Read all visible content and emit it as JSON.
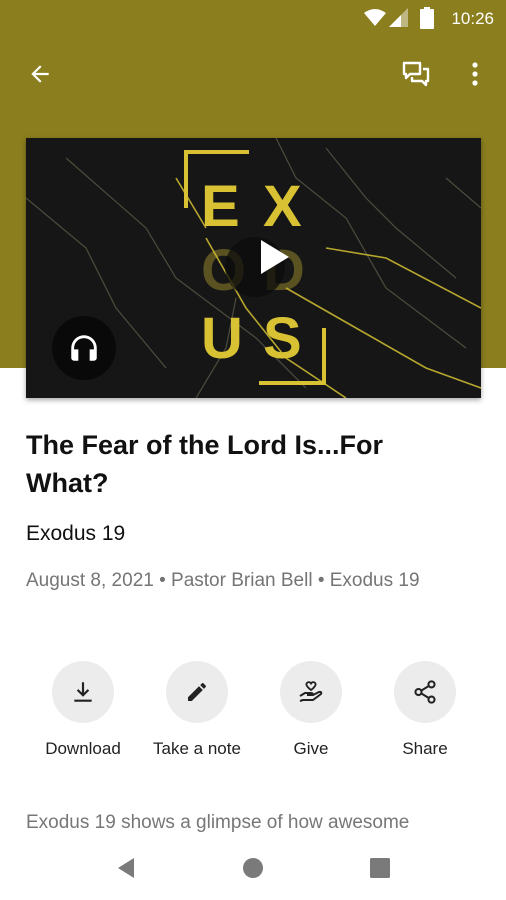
{
  "status_bar": {
    "time": "10:26",
    "icons": [
      "wifi-icon",
      "signal-icon",
      "battery-icon"
    ]
  },
  "toolbar": {
    "back_icon": "arrow-back-icon",
    "chat_icon": "chat-icon",
    "more_icon": "more-vert-icon"
  },
  "colors": {
    "header_band": "#8a7e1f",
    "artwork_accent": "#d8c234",
    "action_circle": "#ececec"
  },
  "media": {
    "artwork_text": [
      "E",
      "X",
      "O",
      "D",
      "U",
      "S"
    ],
    "play_icon": "play-icon",
    "audio_icon": "headphones-icon"
  },
  "sermon": {
    "title": "The Fear of the Lord Is...For What?",
    "subtitle": "Exodus 19",
    "meta": "August 8, 2021 • Pastor Brian Bell • Exodus 19",
    "description": "Exodus 19 shows a glimpse of how awesome"
  },
  "actions": [
    {
      "label": "Download",
      "icon": "download-icon"
    },
    {
      "label": "Take a note",
      "icon": "pencil-icon"
    },
    {
      "label": "Give",
      "icon": "give-heart-hand-icon"
    },
    {
      "label": "Share",
      "icon": "share-icon"
    }
  ],
  "nav": {
    "back_icon": "nav-back-icon",
    "home_icon": "nav-home-icon",
    "recents_icon": "nav-recents-icon"
  }
}
